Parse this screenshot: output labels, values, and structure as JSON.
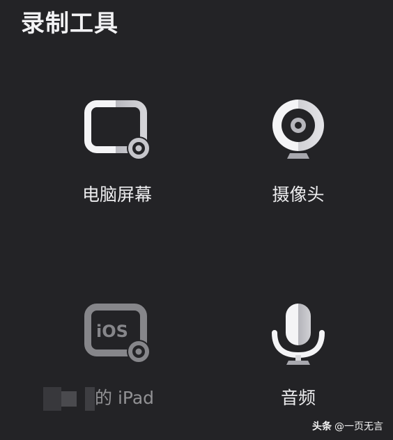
{
  "header": {
    "title": "录制工具"
  },
  "tools": {
    "screen": {
      "label": "电脑屏幕",
      "icon": "screen-record-icon"
    },
    "camera": {
      "label": "摄像头",
      "icon": "webcam-icon"
    },
    "ipad": {
      "label": "的 iPad",
      "icon": "ios-screen-icon",
      "icon_text": "iOS",
      "disabled": true
    },
    "audio": {
      "label": "音频",
      "icon": "microphone-icon"
    }
  },
  "watermark": {
    "brand": "头条",
    "handle": "@一页无言"
  },
  "colors": {
    "background": "#232326",
    "icon_white": "#f4f4f6",
    "icon_gray": "#9c9ca2",
    "text": "#ececee"
  }
}
